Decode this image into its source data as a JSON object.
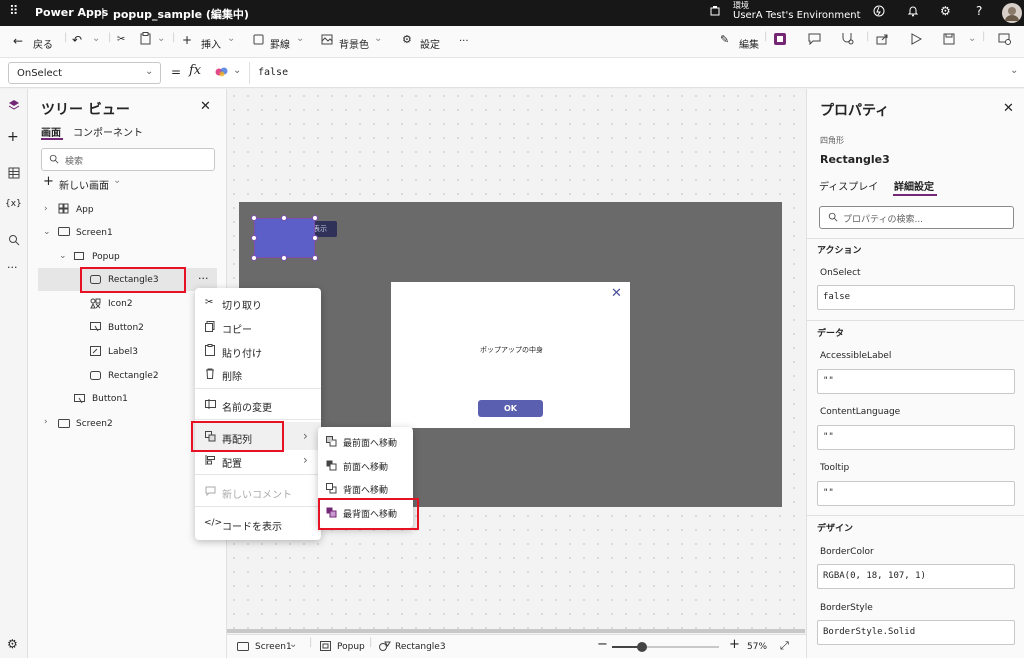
{
  "topbar": {
    "app_name": "Power Apps",
    "separator": "|",
    "file_title": "popup_sample (編集中)",
    "env_label": "環境",
    "env_name": "UserA Test's Environment"
  },
  "toolbar": {
    "back": "戻る",
    "insert": "挿入",
    "border": "罫線",
    "background": "背景色",
    "settings": "設定",
    "more": "···",
    "edit": "編集"
  },
  "formula_bar": {
    "property": "OnSelect",
    "equals": "=",
    "fx": "fx",
    "value": "false"
  },
  "tree": {
    "title": "ツリー ビュー",
    "tabs": [
      "画面",
      "コンポーネント"
    ],
    "search_placeholder": "検索",
    "new_screen": "新しい画面",
    "items": [
      "App",
      "Screen1",
      "Popup",
      "Rectangle3",
      "Icon2",
      "Button2",
      "Label3",
      "Rectangle2",
      "Button1",
      "Screen2"
    ],
    "more": "···"
  },
  "context_menu": {
    "items": [
      "切り取り",
      "コピー",
      "貼り付け",
      "削除",
      "名前の変更",
      "再配列",
      "配置",
      "新しいコメント",
      "コードを表示"
    ]
  },
  "submenu": {
    "items": [
      "最前面へ移動",
      "前面へ移動",
      "背面へ移動",
      "最背面へ移動"
    ]
  },
  "canvas": {
    "hidden_label": "表示",
    "popup_text": "ポップアップの中身",
    "ok_button": "OK"
  },
  "bottom": {
    "screen": "Screen1",
    "popup": "Popup",
    "selected": "Rectangle3",
    "zoom_minus": "−",
    "zoom_plus": "+",
    "zoom": "57%",
    "zoom_level": 0.57
  },
  "properties": {
    "title": "プロパティ",
    "type": "四角形",
    "name": "Rectangle3",
    "tabs": [
      "ディスプレイ",
      "詳細設定"
    ],
    "search_placeholder": "プロパティの検索...",
    "sections": {
      "action": "アクション",
      "data": "データ",
      "design": "デザイン"
    },
    "fields": [
      {
        "label": "OnSelect",
        "value": "false"
      },
      {
        "label": "AccessibleLabel",
        "value": "\"\""
      },
      {
        "label": "ContentLanguage",
        "value": "\"\""
      },
      {
        "label": "Tooltip",
        "value": "\"\""
      },
      {
        "label": "BorderColor",
        "value": "RGBA(0, 18, 107, 1)"
      },
      {
        "label": "BorderStyle",
        "value": "BorderStyle.Solid"
      }
    ]
  },
  "colors": {
    "accent": "#742774",
    "highlight": "#e81123",
    "canvas_screen": "#6a6a6a",
    "rectangle": "#5b5fc7",
    "ok_button": "#5b5fb0"
  }
}
